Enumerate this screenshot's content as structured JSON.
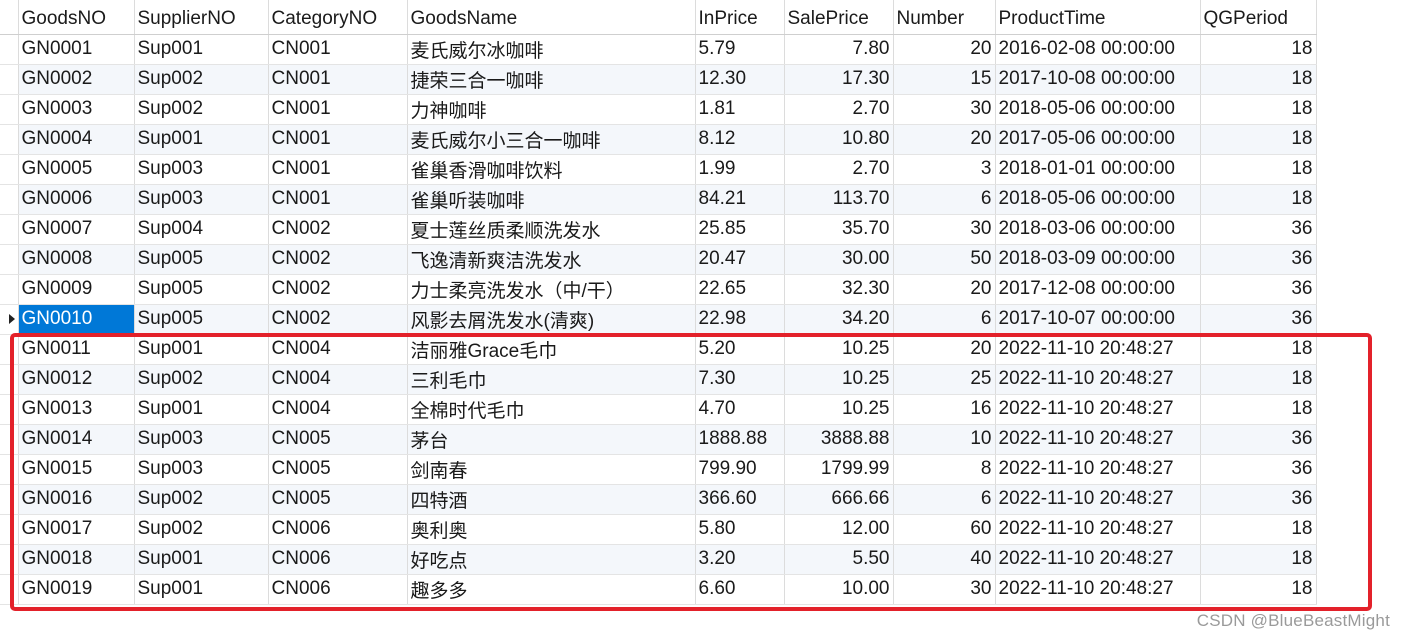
{
  "columns": [
    "GoodsNO",
    "SupplierNO",
    "CategoryNO",
    "GoodsName",
    "InPrice",
    "SalePrice",
    "Number",
    "ProductTime",
    "QGPeriod"
  ],
  "rows": [
    [
      "GN0001",
      "Sup001",
      "CN001",
      "麦氏威尔冰咖啡",
      "5.79",
      "7.80",
      "20",
      "2016-02-08 00:00:00",
      "18"
    ],
    [
      "GN0002",
      "Sup002",
      "CN001",
      "捷荣三合一咖啡",
      "12.30",
      "17.30",
      "15",
      "2017-10-08 00:00:00",
      "18"
    ],
    [
      "GN0003",
      "Sup002",
      "CN001",
      "力神咖啡",
      "1.81",
      "2.70",
      "30",
      "2018-05-06 00:00:00",
      "18"
    ],
    [
      "GN0004",
      "Sup001",
      "CN001",
      "麦氏威尔小三合一咖啡",
      "8.12",
      "10.80",
      "20",
      "2017-05-06 00:00:00",
      "18"
    ],
    [
      "GN0005",
      "Sup003",
      "CN001",
      "雀巢香滑咖啡饮料",
      "1.99",
      "2.70",
      "3",
      "2018-01-01 00:00:00",
      "18"
    ],
    [
      "GN0006",
      "Sup003",
      "CN001",
      "雀巢听装咖啡",
      "84.21",
      "113.70",
      "6",
      "2018-05-06 00:00:00",
      "18"
    ],
    [
      "GN0007",
      "Sup004",
      "CN002",
      "夏士莲丝质柔顺洗发水",
      "25.85",
      "35.70",
      "30",
      "2018-03-06 00:00:00",
      "36"
    ],
    [
      "GN0008",
      "Sup005",
      "CN002",
      "飞逸清新爽洁洗发水",
      "20.47",
      "30.00",
      "50",
      "2018-03-09 00:00:00",
      "36"
    ],
    [
      "GN0009",
      "Sup005",
      "CN002",
      "力士柔亮洗发水（中/干）",
      "22.65",
      "32.30",
      "20",
      "2017-12-08 00:00:00",
      "36"
    ],
    [
      "GN0010",
      "Sup005",
      "CN002",
      "风影去屑洗发水(清爽)",
      "22.98",
      "34.20",
      "6",
      "2017-10-07 00:00:00",
      "36"
    ],
    [
      "GN0011",
      "Sup001",
      "CN004",
      "洁丽雅Grace毛巾",
      "5.20",
      "10.25",
      "20",
      "2022-11-10 20:48:27",
      "18"
    ],
    [
      "GN0012",
      "Sup002",
      "CN004",
      "三利毛巾",
      "7.30",
      "10.25",
      "25",
      "2022-11-10 20:48:27",
      "18"
    ],
    [
      "GN0013",
      "Sup001",
      "CN004",
      "全棉时代毛巾",
      "4.70",
      "10.25",
      "16",
      "2022-11-10 20:48:27",
      "18"
    ],
    [
      "GN0014",
      "Sup003",
      "CN005",
      "茅台",
      "1888.88",
      "3888.88",
      "10",
      "2022-11-10 20:48:27",
      "36"
    ],
    [
      "GN0015",
      "Sup003",
      "CN005",
      "剑南春",
      "799.90",
      "1799.99",
      "8",
      "2022-11-10 20:48:27",
      "36"
    ],
    [
      "GN0016",
      "Sup002",
      "CN005",
      "四特酒",
      "366.60",
      "666.66",
      "6",
      "2022-11-10 20:48:27",
      "36"
    ],
    [
      "GN0017",
      "Sup002",
      "CN006",
      "奥利奥",
      "5.80",
      "12.00",
      "60",
      "2022-11-10 20:48:27",
      "18"
    ],
    [
      "GN0018",
      "Sup001",
      "CN006",
      "好吃点",
      "3.20",
      "5.50",
      "40",
      "2022-11-10 20:48:27",
      "18"
    ],
    [
      "GN0019",
      "Sup001",
      "CN006",
      "趣多多",
      "6.60",
      "10.00",
      "30",
      "2022-11-10 20:48:27",
      "18"
    ]
  ],
  "selected_row": "GN0010",
  "highlight_color": "#e3212a",
  "selection_color": "#0078d7",
  "watermark": "CSDN @BlueBeastMight"
}
